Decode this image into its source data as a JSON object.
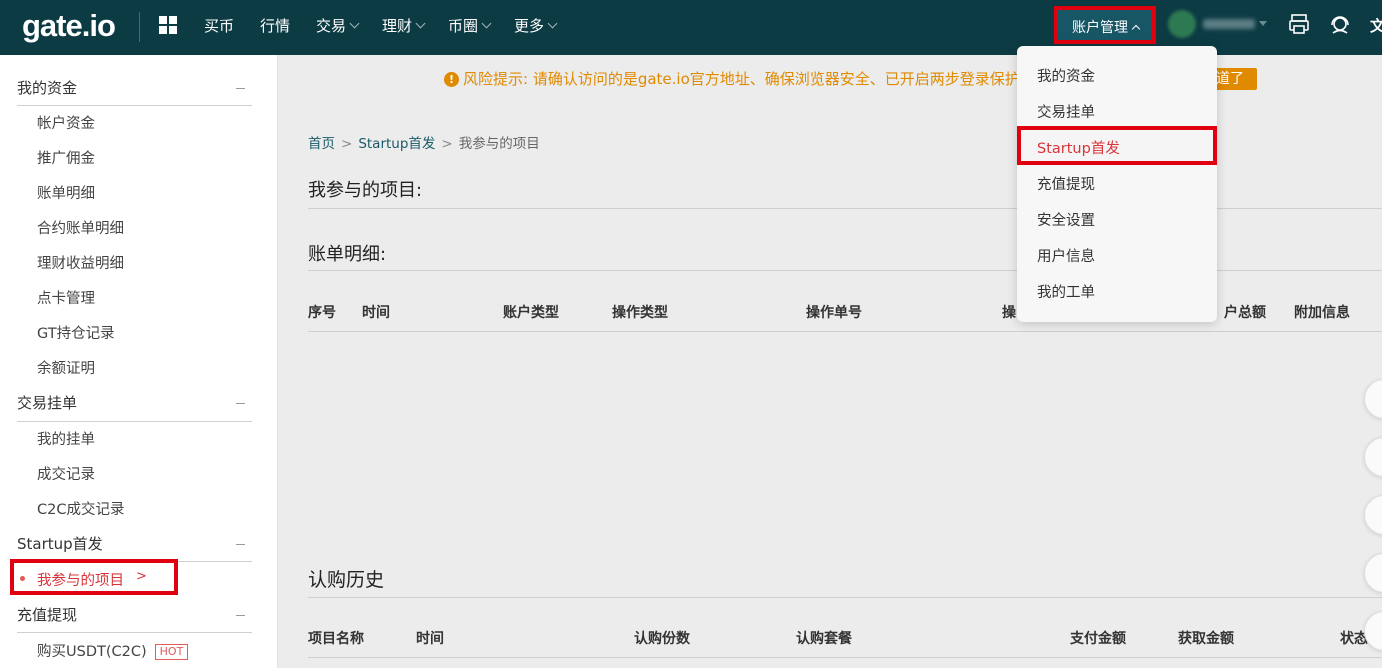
{
  "logo": "gate.io",
  "nav": {
    "buy": "买币",
    "market": "行情",
    "trade": "交易",
    "finance": "理财",
    "community": "币圈",
    "more": "更多",
    "account": "账户管理",
    "lang": "文"
  },
  "risk": {
    "text": "风险提示: 请确认访问的是gate.io官方地址、确保浏览器安全、已开启两步登录保护,",
    "button": "道了"
  },
  "sidebar": {
    "sections": [
      {
        "title": "我的资金",
        "items": [
          "帐户资金",
          "推广佣金",
          "账单明细",
          "合约账单明细",
          "理财收益明细",
          "点卡管理",
          "GT持仓记录",
          "余额证明"
        ]
      },
      {
        "title": "交易挂单",
        "items": [
          "我的挂单",
          "成交记录",
          "C2C成交记录"
        ]
      },
      {
        "title": "Startup首发",
        "items": [
          "我参与的项目"
        ]
      },
      {
        "title": "充值提现",
        "items": [
          "购买USDT(C2C)"
        ]
      }
    ],
    "active_arrow": ">",
    "hot": "HOT"
  },
  "breadcrumb": {
    "home": "首页",
    "section": "Startup首发",
    "current": "我参与的项目",
    "sep": ">"
  },
  "main": {
    "title": "我参与的项目:",
    "bill_title": "账单明细:",
    "bill_headers": [
      "序号",
      "时间",
      "账户类型",
      "操作类型",
      "操作单号",
      "操",
      "户总额",
      "附加信息"
    ],
    "sub_title": "认购历史",
    "sub_headers": [
      "项目名称",
      "时间",
      "认购份数",
      "认购套餐",
      "支付金额",
      "获取金额",
      "状态"
    ]
  },
  "dropdown": {
    "items": [
      "我的资金",
      "交易挂单",
      "Startup首发",
      "充值提现",
      "安全设置",
      "用户信息",
      "我的工单"
    ]
  }
}
